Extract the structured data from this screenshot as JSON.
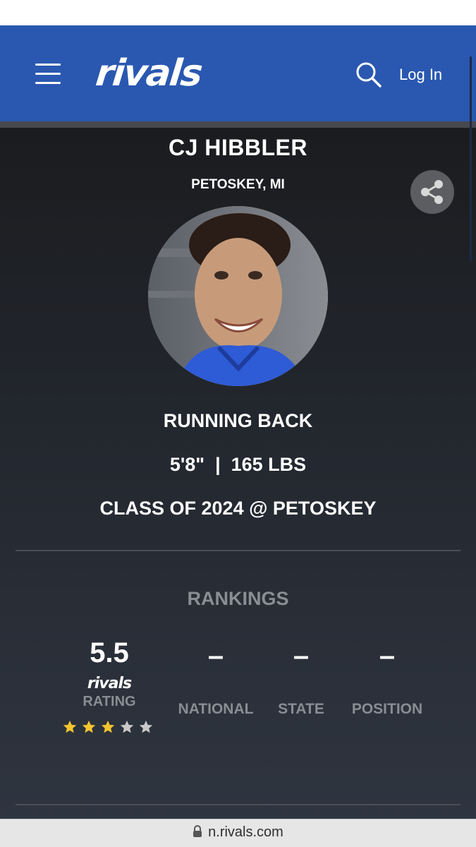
{
  "header": {
    "logo_text": "rivals",
    "login_label": "Log In",
    "background_color": "#2a58b0"
  },
  "profile": {
    "name": "CJ HIBBLER",
    "hometown": "PETOSKEY, MI",
    "position": "RUNNING BACK",
    "measurements": "5'8\"  |  165 LBS",
    "class_line": "CLASS OF 2024 @ PETOSKEY"
  },
  "rankings": {
    "title": "RANKINGS",
    "rating_value": "5.5",
    "rating_logo": "rivals",
    "rating_label": "RATING",
    "stars_filled": 3,
    "stars_total": 5,
    "star_color": "#f4c430",
    "columns": [
      {
        "value": "–",
        "label": "NATIONAL"
      },
      {
        "value": "–",
        "label": "STATE"
      },
      {
        "value": "–",
        "label": "POSITION"
      }
    ]
  },
  "browser": {
    "url": "n.rivals.com"
  },
  "icons": [
    "menu-icon",
    "search-icon",
    "share-icon",
    "star-icon",
    "lock-icon"
  ]
}
